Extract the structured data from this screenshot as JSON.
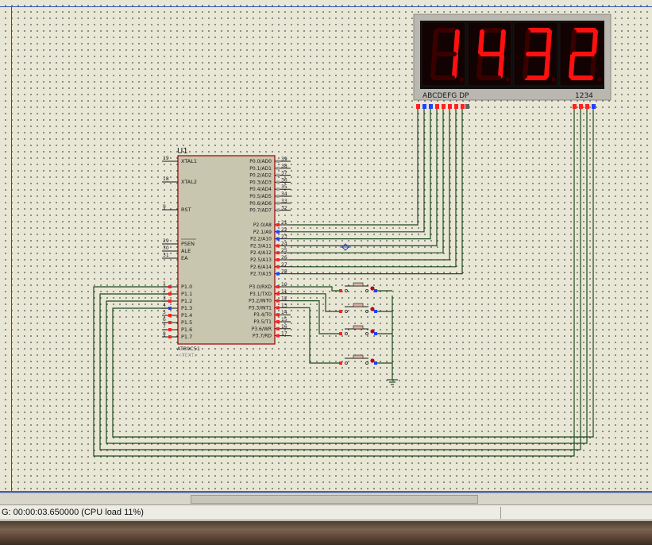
{
  "display": {
    "digits": [
      "1",
      "4",
      "3",
      "2"
    ],
    "segment_label": "ABCDEFG  DP",
    "digit_select_label": "1234"
  },
  "chip": {
    "ref": "U1",
    "part": "AT89C51",
    "text_placeholder": "<TEXT>",
    "left_pins": [
      {
        "num": "19",
        "name": "XTAL1"
      },
      {
        "num": "18",
        "name": "XTAL2"
      },
      {
        "num": "9",
        "name": "RST"
      },
      {
        "num": "29",
        "name": "PSEN"
      },
      {
        "num": "30",
        "name": "ALE"
      },
      {
        "num": "31",
        "name": "EA"
      },
      {
        "num": "1",
        "name": "P1.0"
      },
      {
        "num": "2",
        "name": "P1.1"
      },
      {
        "num": "3",
        "name": "P1.2"
      },
      {
        "num": "4",
        "name": "P1.3"
      },
      {
        "num": "5",
        "name": "P1.4"
      },
      {
        "num": "6",
        "name": "P1.5"
      },
      {
        "num": "7",
        "name": "P1.6"
      },
      {
        "num": "8",
        "name": "P1.7"
      }
    ],
    "right_pins": [
      {
        "num": "39",
        "name": "P0.0/AD0"
      },
      {
        "num": "38",
        "name": "P0.1/AD1"
      },
      {
        "num": "37",
        "name": "P0.2/AD2"
      },
      {
        "num": "36",
        "name": "P0.3/AD3"
      },
      {
        "num": "35",
        "name": "P0.4/AD4"
      },
      {
        "num": "34",
        "name": "P0.5/AD5"
      },
      {
        "num": "33",
        "name": "P0.6/AD6"
      },
      {
        "num": "32",
        "name": "P0.7/AD7"
      },
      {
        "num": "21",
        "name": "P2.0/A8"
      },
      {
        "num": "22",
        "name": "P2.1/A9"
      },
      {
        "num": "23",
        "name": "P2.2/A10"
      },
      {
        "num": "24",
        "name": "P2.3/A11"
      },
      {
        "num": "25",
        "name": "P2.4/A12"
      },
      {
        "num": "26",
        "name": "P2.5/A13"
      },
      {
        "num": "27",
        "name": "P2.6/A14"
      },
      {
        "num": "28",
        "name": "P2.7/A15"
      },
      {
        "num": "10",
        "name": "P3.0/RXD"
      },
      {
        "num": "11",
        "name": "P3.1/TXD"
      },
      {
        "num": "12",
        "name": "P3.2/INT0"
      },
      {
        "num": "13",
        "name": "P3.3/INT1"
      },
      {
        "num": "14",
        "name": "P3.4/T0"
      },
      {
        "num": "15",
        "name": "P3.5/T1"
      },
      {
        "num": "16",
        "name": "P3.6/WR"
      },
      {
        "num": "17",
        "name": "P3.7/RD"
      }
    ]
  },
  "status": {
    "text": "G: 00:00:03.650000 (CPU load 11%)"
  },
  "colors": {
    "wire": "#1f4a1f",
    "segment_on": "#ff1010",
    "segment_off": "#3a0000",
    "pin_high": "#ff2020",
    "pin_low": "#2040ff",
    "chip_body": "#c8c6ae",
    "chip_border": "#a01010"
  }
}
